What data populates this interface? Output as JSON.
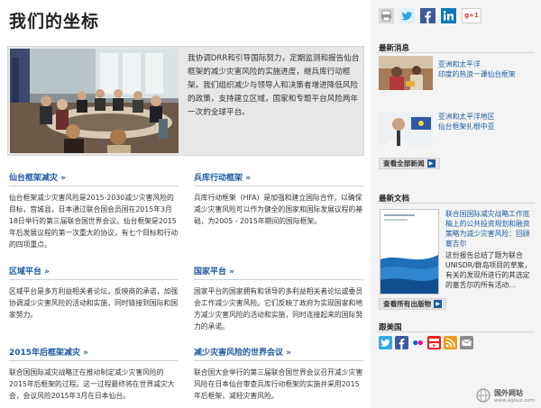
{
  "page_title": "我们的坐标",
  "feature": {
    "text": "我协调DRR和引导国际努力，定期监测和报告仙台框架的减少灾害风险的实施进度，继兵库行动框架。我们组织减少与领导人和决策者增进降低风险的政策，支持建立区域，国家和专题平台风险两年一次的全球平台。"
  },
  "sections": [
    {
      "title": "仙台框架减灾 »",
      "text": "仙台框架减少灾害风险是2015-2030减少灾害风险的目标，宫城县，日本通过联合国会员国在2015年3月18日举行的第三届联合国世界会议。仙台框架是2015年后发展议程的第一次重大的协议，有七个目标和行动的四项重点。"
    },
    {
      "title": "兵库行动框架 »",
      "text": "兵库行动框架（HFA）是加强和建立国际合作，以确保减少灾害风险可以作为健全的国家和国际发展议程的基础，为2005 - 2015年期间的国际框架。"
    },
    {
      "title": "区域平台 »",
      "text": "区域平台是多方利益相关者论坛，反映商的承诺，加强协调减少灾害风险的活动和实施，同时链接到国际和国家努力。"
    },
    {
      "title": "国家平台 »",
      "text": "国家平台的国家拥有和领导的多利益相关者论坛或委员会工作减少灾害风险。它们反映了政府为实现国家和地方减少灾害风险的活动和实施，同时连接起来的国际努力的承诺。"
    },
    {
      "title": "2015年后框架减灾 »",
      "text": "联合国国际减灾战略正在推动制定减少灾害风险的2015年后框架的过程。这一过程最终将在世界减灾大会，会议风险2015年3月在日本仙台。"
    },
    {
      "title": "减少灾害风险的世界会议 »",
      "text": "联合国大会举行的第三届联合国世界会议召开减少灾害风险在日本仙台审查兵库行动框架的实施并采用2015年后框架，减轻灾害风险。"
    }
  ],
  "share": {
    "icons": [
      "print-icon",
      "twitter-icon",
      "facebook-icon",
      "linkedin-icon",
      "google-plus-icon"
    ],
    "gplus_label": "g+1"
  },
  "sidebar": {
    "news_heading": "最新消息",
    "news": [
      {
        "region": "亚洲和太平洋",
        "title": "印度的热浪一课仙台框架"
      },
      {
        "region": "亚洲和太平洋地区",
        "title": "仙台框架扎根中亚"
      }
    ],
    "news_more": "查看全部新闻",
    "docs_heading": "最新文档",
    "doc": {
      "title": "联合国国际减灾战略工作底稿上的公共投资规划和融资策略为减少灾害风险：回顾塞吉尔",
      "desc": "这份报告总结了题为联合UNISDR/群岛项目的草案，有关的发现所进行的其选定的塞舌尔的所有活动..."
    },
    "docs_more": "查看所有出版物",
    "follow_heading": "跟美国",
    "follow_icons": [
      "twitter-icon",
      "facebook-icon",
      "flickr-icon",
      "youtube-icon",
      "rss-icon",
      "email-icon"
    ]
  },
  "watermark": {
    "name": "国外网站",
    "url": "www.egouz.com"
  },
  "colors": {
    "link": "#1c5aa5",
    "sidebar_bg": "#f4f4f4",
    "feature_bg": "#e7e7e7"
  }
}
